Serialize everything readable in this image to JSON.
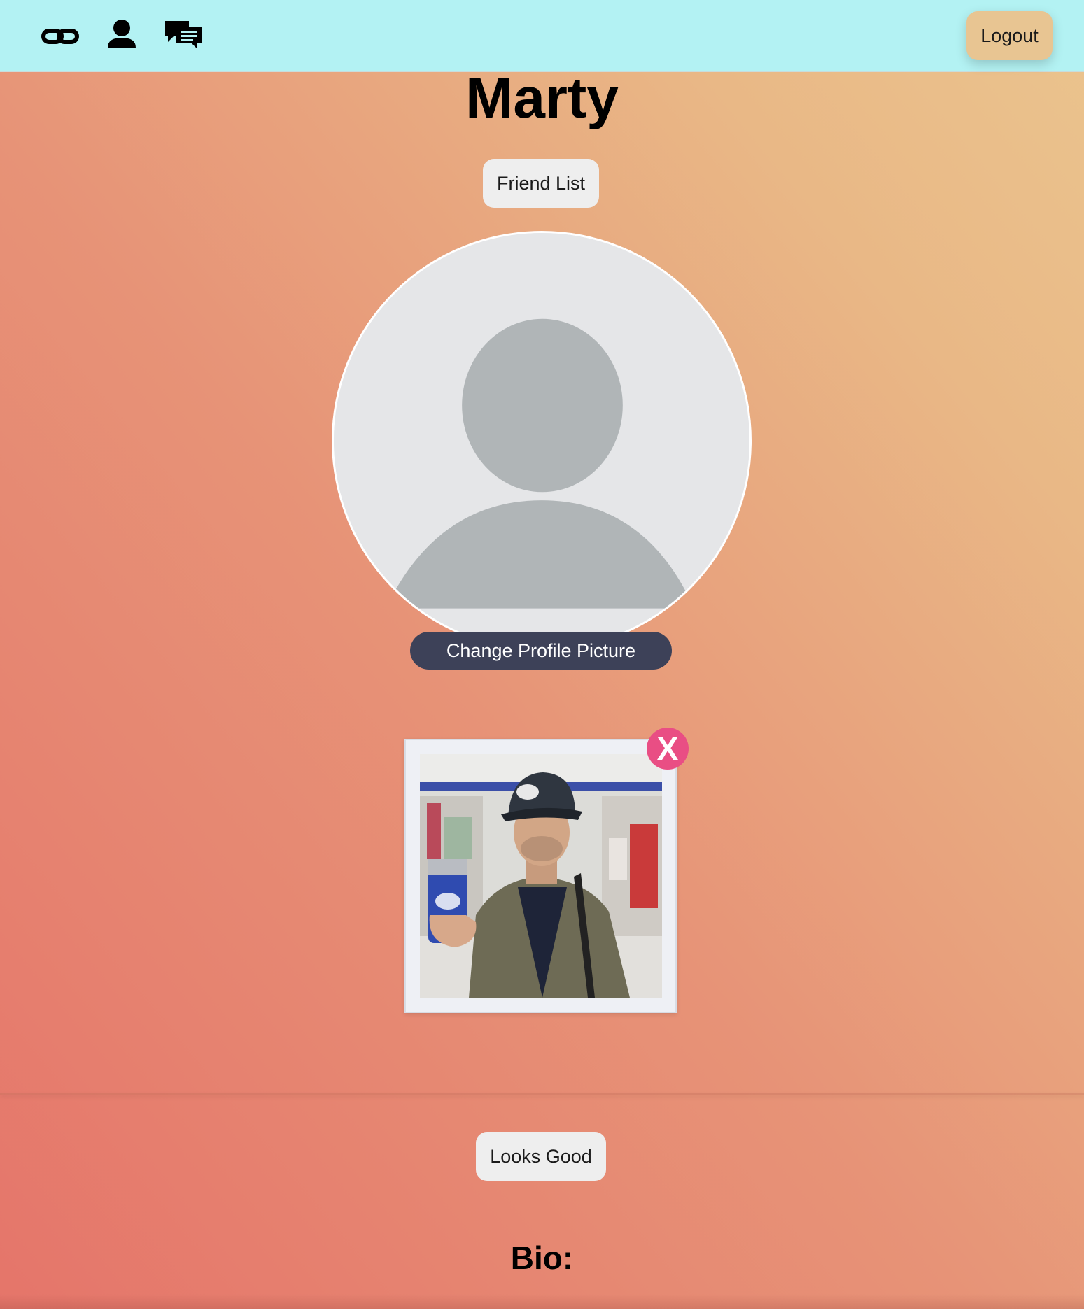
{
  "navbar": {
    "icons": [
      "link-icon",
      "user-icon",
      "chat-icon"
    ],
    "logout_label": "Logout",
    "background": "#b3f2f3"
  },
  "profile": {
    "name": "Marty",
    "friend_list_label": "Friend List",
    "change_picture_label": "Change Profile Picture",
    "remove_label": "X",
    "looks_good_label": "Looks Good",
    "bio_label": "Bio:"
  },
  "colors": {
    "logout_bg": "#e8c592",
    "change_picture_bg": "#3d4158",
    "remove_bg": "#e94e84",
    "pill_bg": "#eeeeee"
  }
}
